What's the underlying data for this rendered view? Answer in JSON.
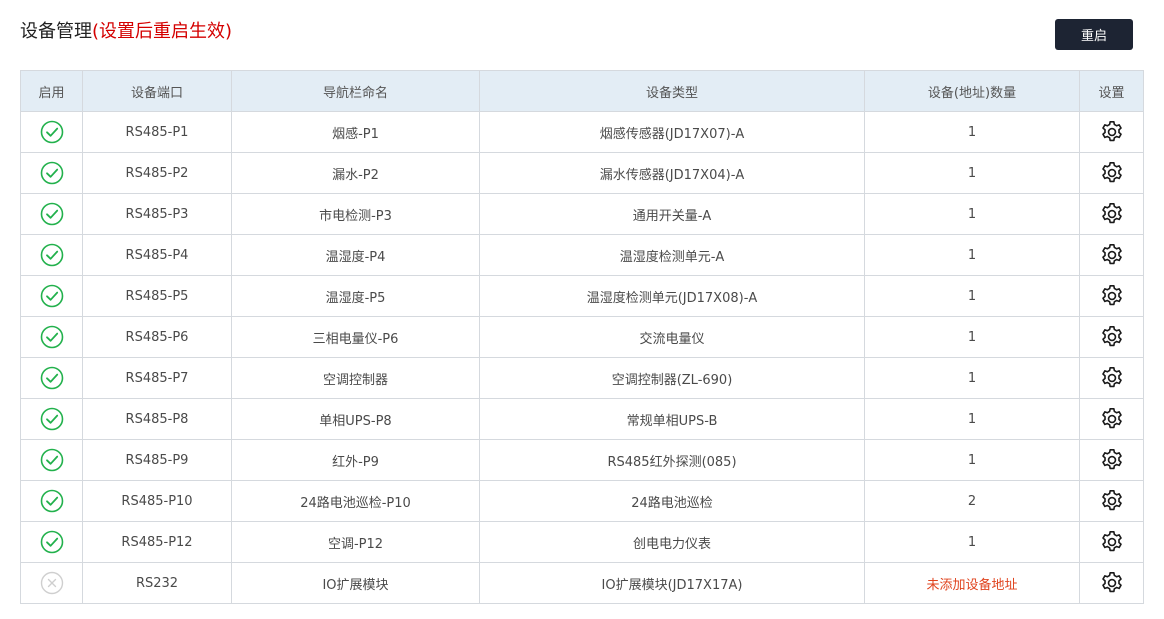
{
  "header": {
    "title": "设备管理",
    "note": "(设置后重启生效)",
    "restart_label": "重启"
  },
  "table": {
    "columns": [
      "启用",
      "设备端口",
      "导航栏命名",
      "设备类型",
      "设备(地址)数量",
      "设置"
    ],
    "rows": [
      {
        "enabled": true,
        "port": "RS485-P1",
        "nav_name": "烟感-P1",
        "type": "烟感传感器(JD17X07)-A",
        "count": "1"
      },
      {
        "enabled": true,
        "port": "RS485-P2",
        "nav_name": "漏水-P2",
        "type": "漏水传感器(JD17X04)-A",
        "count": "1"
      },
      {
        "enabled": true,
        "port": "RS485-P3",
        "nav_name": "市电检测-P3",
        "type": "通用开关量-A",
        "count": "1"
      },
      {
        "enabled": true,
        "port": "RS485-P4",
        "nav_name": "温湿度-P4",
        "type": "温湿度检测单元-A",
        "count": "1"
      },
      {
        "enabled": true,
        "port": "RS485-P5",
        "nav_name": "温湿度-P5",
        "type": "温湿度检测单元(JD17X08)-A",
        "count": "1"
      },
      {
        "enabled": true,
        "port": "RS485-P6",
        "nav_name": "三相电量仪-P6",
        "type": "交流电量仪",
        "count": "1"
      },
      {
        "enabled": true,
        "port": "RS485-P7",
        "nav_name": "空调控制器",
        "type": "空调控制器(ZL-690)",
        "count": "1"
      },
      {
        "enabled": true,
        "port": "RS485-P8",
        "nav_name": "单相UPS-P8",
        "type": "常规单相UPS-B",
        "count": "1"
      },
      {
        "enabled": true,
        "port": "RS485-P9",
        "nav_name": "红外-P9",
        "type": "RS485红外探测(085)",
        "count": "1"
      },
      {
        "enabled": true,
        "port": "RS485-P10",
        "nav_name": "24路电池巡检-P10",
        "type": "24路电池巡检",
        "count": "2"
      },
      {
        "enabled": true,
        "port": "RS485-P12",
        "nav_name": "空调-P12",
        "type": "创电电力仪表",
        "count": "1"
      },
      {
        "enabled": false,
        "port": "RS232",
        "nav_name": "IO扩展模块",
        "type": "IO扩展模块(JD17X17A)",
        "count": "未添加设备地址"
      }
    ]
  },
  "colors": {
    "enabled_green": "#22b14c",
    "disabled_gray": "#cfcfcf",
    "header_bg": "#e3edf5",
    "button_bg": "#1d2433",
    "warning_text": "#e0441f",
    "title_note": "#d40000"
  },
  "icons": {
    "enabled": "check-circle-icon",
    "disabled": "x-circle-icon",
    "settings": "gear-icon"
  }
}
